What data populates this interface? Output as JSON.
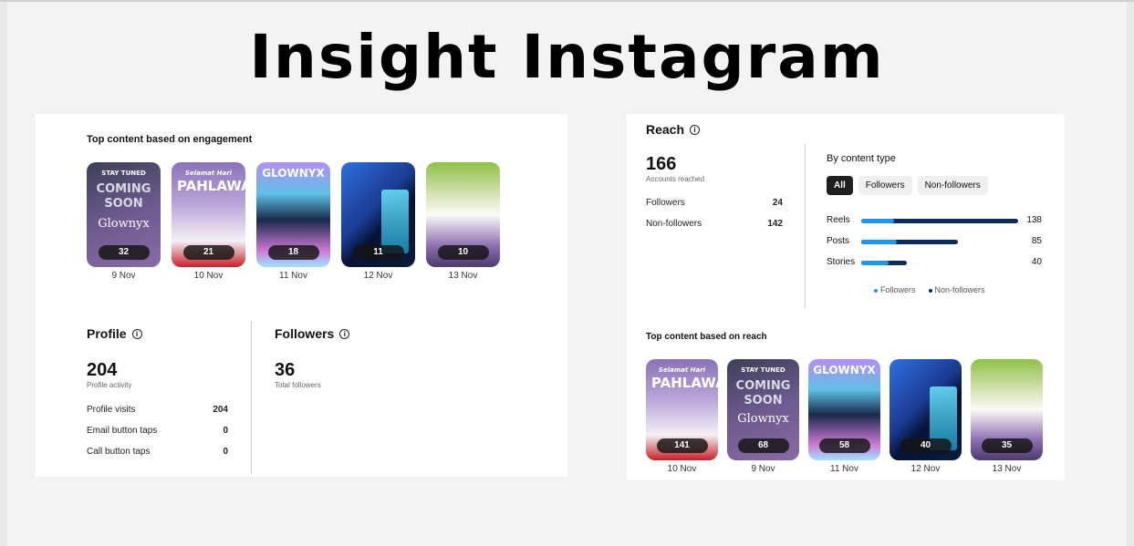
{
  "page_title": "Insight Instagram",
  "colors": {
    "followers": "#2196e8",
    "non_followers": "#0d2c5e"
  },
  "left_card": {
    "top_content_title": "Top content based on engagement",
    "thumbnails": [
      {
        "style": "coming",
        "text1": "STAY TUNED",
        "text2": "COMING SOON",
        "text3": "Glownyx",
        "count": "32",
        "date": "9 Nov"
      },
      {
        "style": "pahlawan",
        "text1": "Selamat Hari",
        "text2": "PAHLAWAN",
        "text3": "",
        "count": "21",
        "date": "10 Nov"
      },
      {
        "style": "glownyx",
        "text1": "GLOWNYX",
        "text2": "",
        "text3": "",
        "count": "18",
        "date": "11 Nov"
      },
      {
        "style": "dark",
        "text1": "",
        "text2": "",
        "text3": "",
        "count": "11",
        "date": "12 Nov"
      },
      {
        "style": "oil",
        "text1": "",
        "text2": "",
        "text3": "",
        "count": "10",
        "date": "13 Nov"
      }
    ],
    "profile": {
      "title": "Profile",
      "value": "204",
      "value_label": "Profile activity",
      "rows": [
        {
          "label": "Profile visits",
          "value": "204"
        },
        {
          "label": "Email button taps",
          "value": "0"
        },
        {
          "label": "Call button taps",
          "value": "0"
        }
      ]
    },
    "followers": {
      "title": "Followers",
      "value": "36",
      "value_label": "Total followers"
    }
  },
  "right_card": {
    "reach": {
      "title": "Reach",
      "value": "166",
      "value_label": "Accounts reached",
      "rows": [
        {
          "label": "Followers",
          "value": "24"
        },
        {
          "label": "Non-followers",
          "value": "142"
        }
      ]
    },
    "by_content": {
      "title": "By content type",
      "filters": [
        "All",
        "Followers",
        "Non-followers"
      ],
      "active_filter": "All",
      "bars": [
        {
          "label": "Reels",
          "total": 138,
          "followers_fraction": 0.21,
          "value": "138"
        },
        {
          "label": "Posts",
          "total": 85,
          "followers_fraction": 0.37,
          "value": "85"
        },
        {
          "label": "Stories",
          "total": 40,
          "followers_fraction": 0.6,
          "value": "40"
        }
      ],
      "max_total": 138,
      "legend": [
        "Followers",
        "Non-followers"
      ]
    },
    "top_content_title": "Top content based on reach",
    "thumbnails": [
      {
        "style": "pahlawan",
        "text1": "Selamat Hari",
        "text2": "PAHLAWAN",
        "text3": "",
        "count": "141",
        "date": "10 Nov"
      },
      {
        "style": "coming",
        "text1": "STAY TUNED",
        "text2": "COMING SOON",
        "text3": "Glownyx",
        "count": "68",
        "date": "9 Nov"
      },
      {
        "style": "glownyx",
        "text1": "GLOWNYX",
        "text2": "",
        "text3": "",
        "count": "58",
        "date": "11 Nov"
      },
      {
        "style": "dark",
        "text1": "",
        "text2": "",
        "text3": "",
        "count": "40",
        "date": "12 Nov"
      },
      {
        "style": "oil",
        "text1": "",
        "text2": "",
        "text3": "",
        "count": "35",
        "date": "13 Nov"
      }
    ]
  }
}
